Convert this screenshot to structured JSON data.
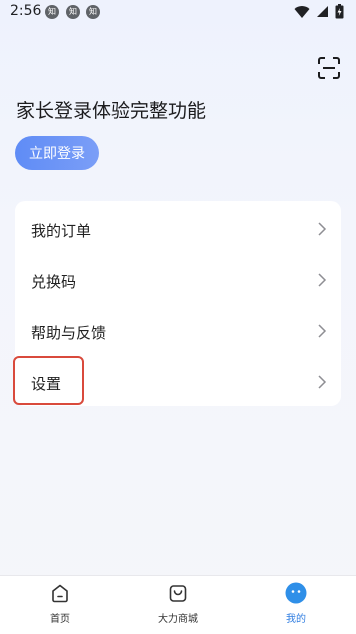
{
  "status_bar": {
    "time": "2:56",
    "notifications": [
      "知",
      "知",
      "知"
    ]
  },
  "header": {
    "title": "家长登录体验完整功能",
    "login_label": "立即登录"
  },
  "menu": {
    "items": [
      {
        "label": "我的订单"
      },
      {
        "label": "兑换码"
      },
      {
        "label": "帮助与反馈"
      },
      {
        "label": "设置"
      }
    ]
  },
  "tabbar": {
    "tabs": [
      {
        "label": "首页",
        "icon": "home-icon"
      },
      {
        "label": "大力商城",
        "icon": "shopping-bag-icon"
      },
      {
        "label": "我的",
        "icon": "profile-face-icon"
      }
    ],
    "active_index": 2
  },
  "colors": {
    "accent": "#2f7de1",
    "login_button": "#6a93f6",
    "highlight": "#d94a3c"
  }
}
